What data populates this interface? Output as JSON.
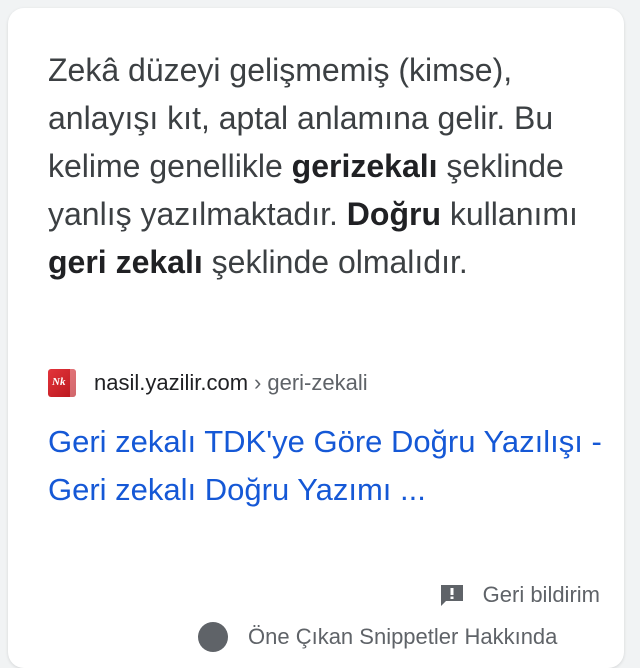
{
  "snippet": {
    "text_1": "Zekâ düzeyi gelişmemiş (kimse), anlayışı kıt, aptal anlamına gelir. Bu kelime genellikle ",
    "bold_1": "gerizekalı",
    "text_2": " şeklinde yanlış yazılmaktadır. ",
    "bold_2": "Doğru",
    "text_3": " kullanımı ",
    "bold_3": "geri zekalı",
    "text_4": " şeklinde olmalıdır."
  },
  "source": {
    "favicon_text": "Nk",
    "domain": "nasil.yazilir.com",
    "separator": "›",
    "path": "geri-zekali"
  },
  "result": {
    "title": "Geri zekalı TDK'ye Göre Doğru Yazılışı - Geri zekalı Doğru Yazımı ..."
  },
  "feedback": {
    "label": "Geri bildirim",
    "icon": "feedback-flag-icon"
  },
  "about": {
    "label": "Öne Çıkan Snippetler Hakkında",
    "icon": "help-circle-icon"
  },
  "colors": {
    "link": "#1558d6",
    "text": "#3c4043",
    "muted": "#5f6368",
    "favicon": "#d9262e"
  }
}
